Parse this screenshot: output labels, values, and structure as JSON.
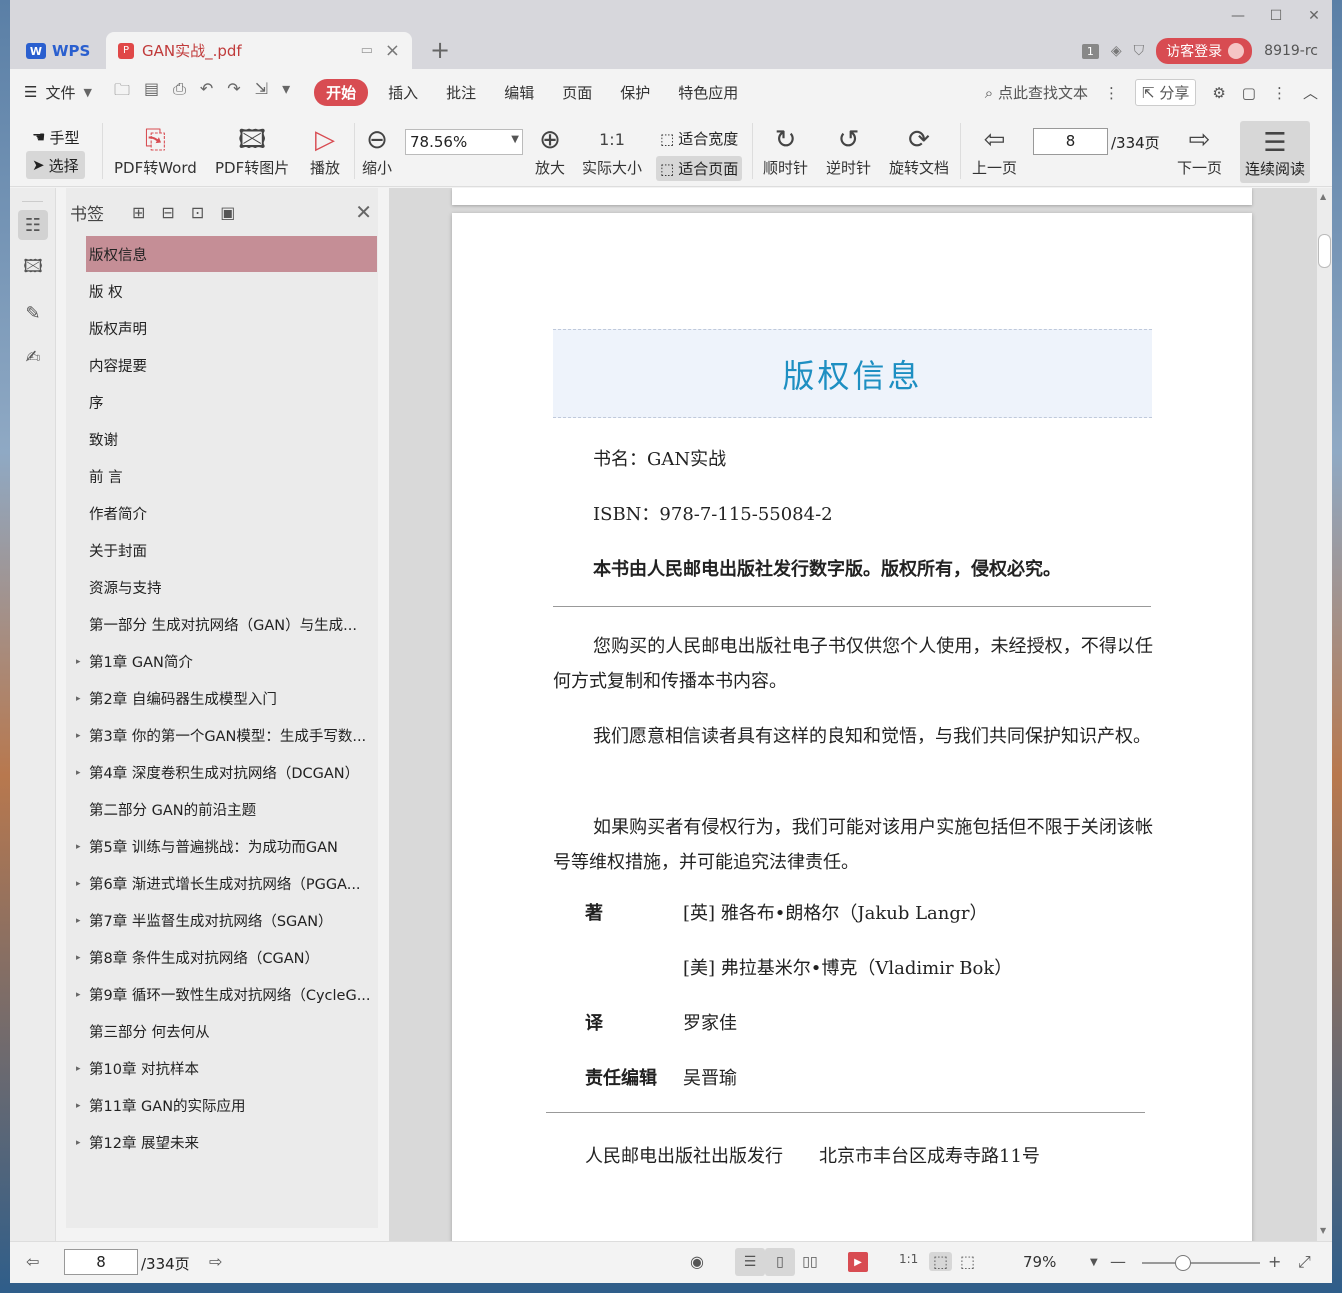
{
  "titlebar": {
    "app_tab": "WPS",
    "doc_tab": "GAN实战_.pdf",
    "badge_num": "1",
    "login_label": "访客登录",
    "user": "8919-rc"
  },
  "menubar": {
    "file": "文件",
    "items": [
      "开始",
      "插入",
      "批注",
      "编辑",
      "页面",
      "保护",
      "特色应用"
    ],
    "search": "点此查找文本",
    "share": "分享"
  },
  "toolbar": {
    "hand": "手型",
    "select": "选择",
    "pdf_word": "PDF转Word",
    "pdf_img": "PDF转图片",
    "play": "播放",
    "zoom_out": "缩小",
    "zoom_value": "78.56%",
    "zoom_in": "放大",
    "actual": "实际大小",
    "fit_width": "适合宽度",
    "fit_page": "适合页面",
    "cw": "顺时针",
    "ccw": "逆时针",
    "rotate": "旋转文档",
    "prev": "上一页",
    "page": "8",
    "page_total": "/334页",
    "next": "下一页",
    "continuous": "连续阅读"
  },
  "bookmarks": {
    "title": "书签",
    "items": [
      {
        "label": "版权信息",
        "expandable": false
      },
      {
        "label": "版 权",
        "expandable": false
      },
      {
        "label": "版权声明",
        "expandable": false
      },
      {
        "label": "内容提要",
        "expandable": false
      },
      {
        "label": "序",
        "expandable": false
      },
      {
        "label": "致谢",
        "expandable": false
      },
      {
        "label": "前 言",
        "expandable": false
      },
      {
        "label": "作者简介",
        "expandable": false
      },
      {
        "label": "关于封面",
        "expandable": false
      },
      {
        "label": "资源与支持",
        "expandable": false
      },
      {
        "label": "第一部分 生成对抗网络（GAN）与生成...",
        "expandable": false
      },
      {
        "label": "第1章 GAN简介",
        "expandable": true
      },
      {
        "label": "第2章 自编码器生成模型入门",
        "expandable": true
      },
      {
        "label": "第3章 你的第一个GAN模型：生成手写数...",
        "expandable": true
      },
      {
        "label": "第4章 深度卷积生成对抗网络（DCGAN）",
        "expandable": true
      },
      {
        "label": "第二部分 GAN的前沿主题",
        "expandable": false
      },
      {
        "label": "第5章 训练与普遍挑战：为成功而GAN",
        "expandable": true
      },
      {
        "label": "第6章 渐进式增长生成对抗网络（PGGA...",
        "expandable": true
      },
      {
        "label": "第7章 半监督生成对抗网络（SGAN）",
        "expandable": true
      },
      {
        "label": "第8章 条件生成对抗网络（CGAN）",
        "expandable": true
      },
      {
        "label": "第9章 循环一致性生成对抗网络（CycleG...",
        "expandable": true
      },
      {
        "label": "第三部分 何去何从",
        "expandable": false
      },
      {
        "label": "第10章 对抗样本",
        "expandable": true
      },
      {
        "label": "第11章 GAN的实际应用",
        "expandable": true
      },
      {
        "label": "第12章 展望未来",
        "expandable": true
      }
    ]
  },
  "document": {
    "heading": "版权信息",
    "book_name": "书名：GAN实战",
    "isbn": "ISBN：978-7-115-55084-2",
    "notice": "本书由人民邮电出版社发行数字版。版权所有，侵权必究。",
    "para1": "您购买的人民邮电出版社电子书仅供您个人使用，未经授权，不得以任何方式复制和传播本书内容。",
    "para2": "我们愿意相信读者具有这样的良知和觉悟，与我们共同保护知识产权。",
    "para3": "如果购买者有侵权行为，我们可能对该用户实施包括但不限于关闭该帐号等维权措施，并可能追究法律责任。",
    "author_label": "著",
    "author1": "[英] 雅各布•朗格尔（Jakub Langr）",
    "author2": "[美] 弗拉基米尔•博克（Vladimir Bok）",
    "translator_label": "译",
    "translator": "罗家佳",
    "editor_label": "责任编辑",
    "editor": "吴晋瑜",
    "publisher": "人民邮电出版社出版发行　　北京市丰台区成寿寺路11号"
  },
  "statusbar": {
    "page": "8",
    "page_total": "/334页",
    "zoom": "79%",
    "zoom_fraction": 0.35
  },
  "colors": {
    "accent": "#d84c52",
    "heading_blue": "#1e8fc2",
    "selected_bookmark": "#c58e96"
  }
}
